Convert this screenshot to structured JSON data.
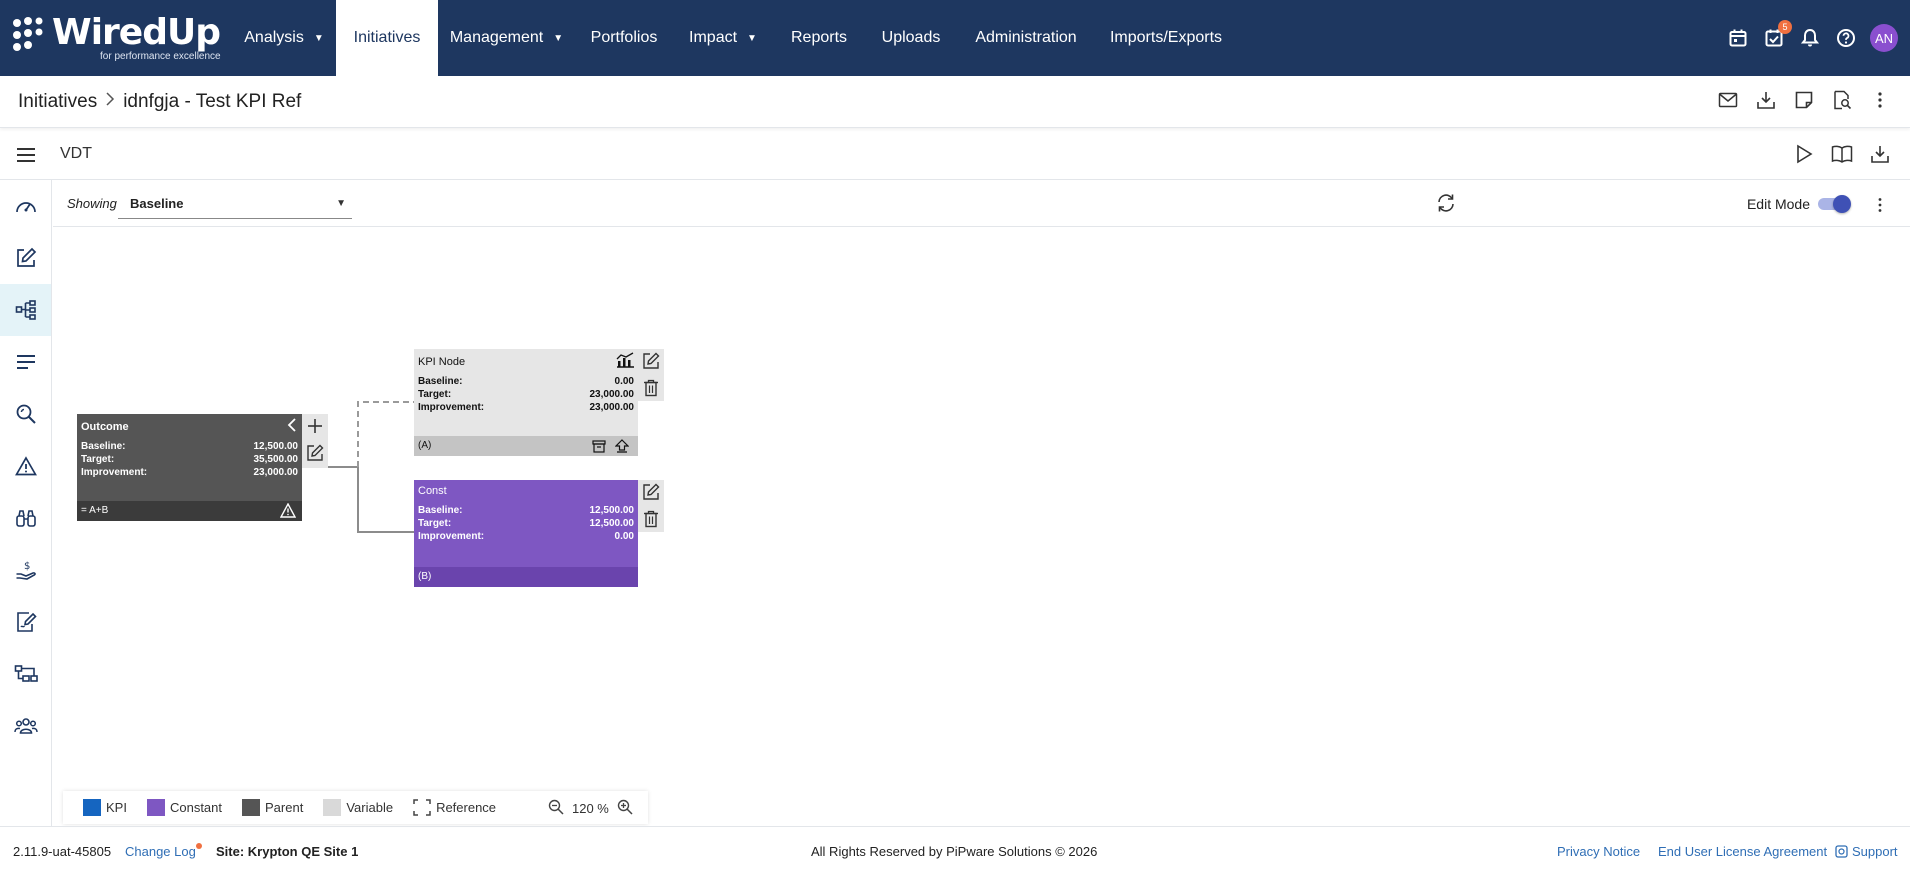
{
  "app": {
    "logo_text": "WiredUp",
    "logo_tagline": "for performance excellence"
  },
  "nav": {
    "items": [
      {
        "label": "Analysis",
        "dropdown": true
      },
      {
        "label": "Initiatives",
        "dropdown": false,
        "active": true
      },
      {
        "label": "Management",
        "dropdown": true
      },
      {
        "label": "Portfolios",
        "dropdown": false
      },
      {
        "label": "Impact",
        "dropdown": true
      },
      {
        "label": "Reports",
        "dropdown": false
      },
      {
        "label": "Uploads",
        "dropdown": false
      },
      {
        "label": "Administration",
        "dropdown": false
      },
      {
        "label": "Imports/Exports",
        "dropdown": false
      }
    ],
    "tasks_badge": "5",
    "avatar_initials": "AN",
    "colors": {
      "bg": "#1e3760",
      "avatar": "#8a4fcf",
      "badge": "#f07040"
    }
  },
  "breadcrumb": {
    "root": "Initiatives",
    "current": "idnfgja - Test KPI Ref"
  },
  "vdt": {
    "title": "VDT"
  },
  "showing": {
    "label": "Showing",
    "selected": "Baseline",
    "edit_mode_label": "Edit Mode",
    "edit_mode_on": true
  },
  "nodes": {
    "outcome": {
      "title": "Outcome",
      "baseline_label": "Baseline:",
      "baseline": "12,500.00",
      "target_label": "Target:",
      "target": "35,500.00",
      "improvement_label": "Improvement:",
      "improvement": "23,000.00",
      "formula": "= A+B",
      "color": "#555555"
    },
    "kpi": {
      "title": "KPI Node",
      "baseline_label": "Baseline:",
      "baseline": "0.00",
      "target_label": "Target:",
      "target": "23,000.00",
      "improvement_label": "Improvement:",
      "improvement": "23,000.00",
      "ref": "(A)",
      "color": "#e6e6e6"
    },
    "const": {
      "title": "Const",
      "baseline_label": "Baseline:",
      "baseline": "12,500.00",
      "target_label": "Target:",
      "target": "12,500.00",
      "improvement_label": "Improvement:",
      "improvement": "0.00",
      "ref": "(B)",
      "color": "#7e57c2"
    }
  },
  "legend": {
    "items": [
      {
        "label": "KPI",
        "color": "#1565c0"
      },
      {
        "label": "Constant",
        "color": "#7e57c2"
      },
      {
        "label": "Parent",
        "color": "#555555"
      },
      {
        "label": "Variable",
        "color": "#d9d9d9"
      },
      {
        "label": "Reference",
        "color": "dashed"
      }
    ],
    "zoom": "120 %"
  },
  "footer": {
    "version": "2.11.9-uat-45805",
    "change_log": "Change Log",
    "site": "Site: Krypton QE Site 1",
    "copyright": "All Rights Reserved by PiPware Solutions © 2026",
    "privacy": "Privacy Notice",
    "eula": "End User License Agreement",
    "support": "Support"
  }
}
